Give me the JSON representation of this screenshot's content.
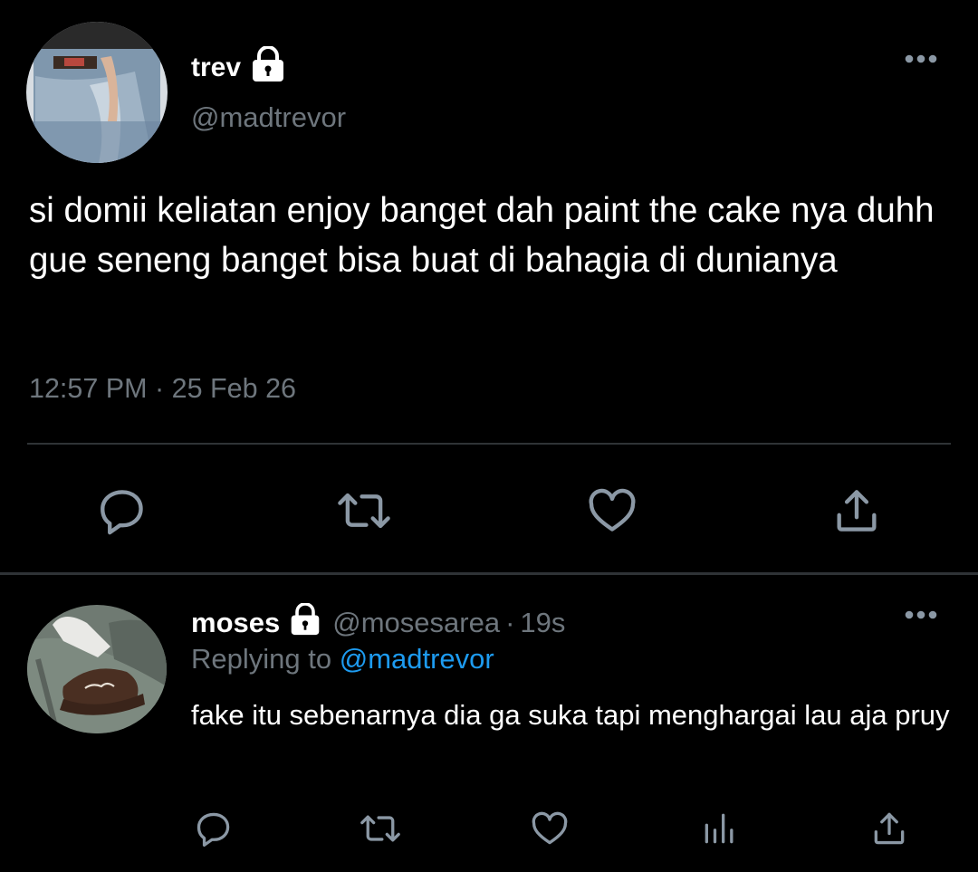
{
  "tweet": {
    "display_name": "trev",
    "handle": "@madtrevor",
    "text": "si domii keliatan enjoy banget dah paint the cake nya duhh gue seneng banget bisa buat di bahagia di dunianya",
    "timestamp": "12:57 PM · 25 Feb 26",
    "locked_icon": "lock-icon",
    "actions": [
      "reply-icon",
      "retweet-icon",
      "like-icon",
      "share-icon"
    ]
  },
  "reply": {
    "display_name": "moses",
    "handle": "@mosesarea",
    "separator": "·",
    "time": "19s",
    "replying_prefix": "Replying to",
    "replying_to": "@madtrevor",
    "text": "fake itu sebenarnya dia ga suka tapi menghargai lau aja pruy",
    "locked_icon": "lock-icon",
    "actions": [
      "reply-icon",
      "retweet-icon",
      "like-icon",
      "analytics-icon",
      "share-icon"
    ]
  },
  "colors": {
    "background": "#000000",
    "text": "#ffffff",
    "secondary_text": "#6e767d",
    "link": "#1d9bf0",
    "icon": "#8b98a5",
    "divider": "#2f3336"
  }
}
